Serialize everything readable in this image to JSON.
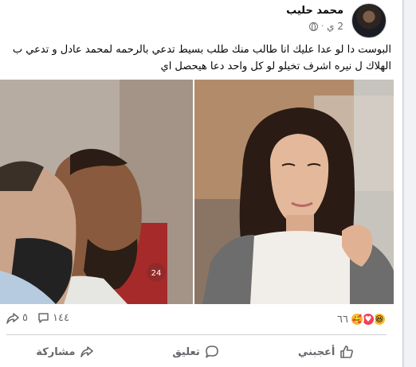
{
  "post": {
    "author": "محمد حليب",
    "time": "2 ي",
    "privacy_icon": "globe-icon",
    "text": "البوست دا لو عدا عليك انا طالب منك طلب بسيط تدعي بالرحمه لمحمد عادل و تدعي ب الهلاك ل نيره اشرف تخيلو لو كل واحد دعا هيحصل اي",
    "image_watermark": "24"
  },
  "stats": {
    "reaction_count": "٦٦",
    "comments_count": "١٤٤",
    "shares_count": "٥",
    "reaction_icons": [
      "haha-icon",
      "love-icon",
      "care-icon"
    ]
  },
  "actions": {
    "like_label": "أعجبني",
    "comment_label": "تعليق",
    "share_label": "مشاركة"
  },
  "colors": {
    "secondary_text": "#65676b",
    "love": "#f33e58",
    "haha": "#f7b928"
  }
}
